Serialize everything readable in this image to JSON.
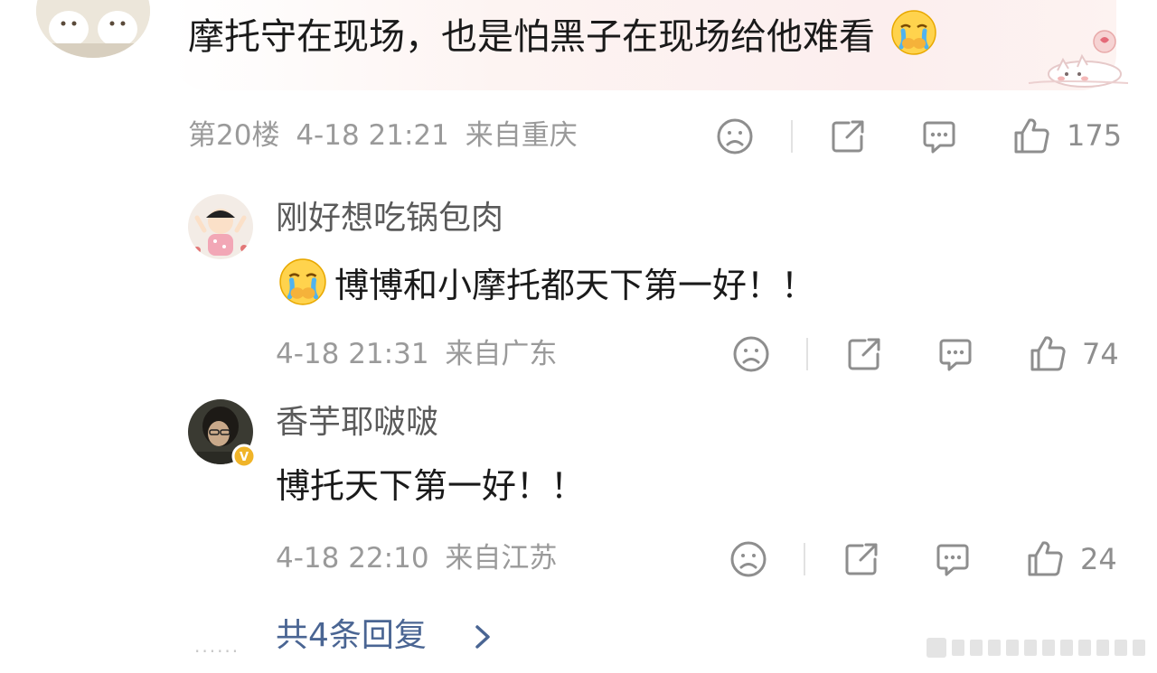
{
  "main_comment": {
    "text": "摩托守在现场，也是怕黑子在现场给他难看",
    "floor": "第20楼",
    "time": "4-18 21:21",
    "location": "来自重庆",
    "likes": "175"
  },
  "replies": [
    {
      "username": "刚好想吃锅包肉",
      "text": "博博和小摩托都天下第一好！！",
      "time": "4-18 21:31",
      "location": "来自广东",
      "likes": "74"
    },
    {
      "username": "香芋耶啵啵",
      "text": "博托天下第一好！！",
      "time": "4-18 22:10",
      "location": "来自江苏",
      "likes": "24",
      "verified": "V"
    }
  ],
  "more_replies": "共4条回复",
  "more_dots": "......",
  "colors": {
    "meta_gray": "#9a9a9a",
    "link_blue": "#4a6593",
    "verified_gold": "#f0b429",
    "bubble_pink": "#fceeee"
  }
}
